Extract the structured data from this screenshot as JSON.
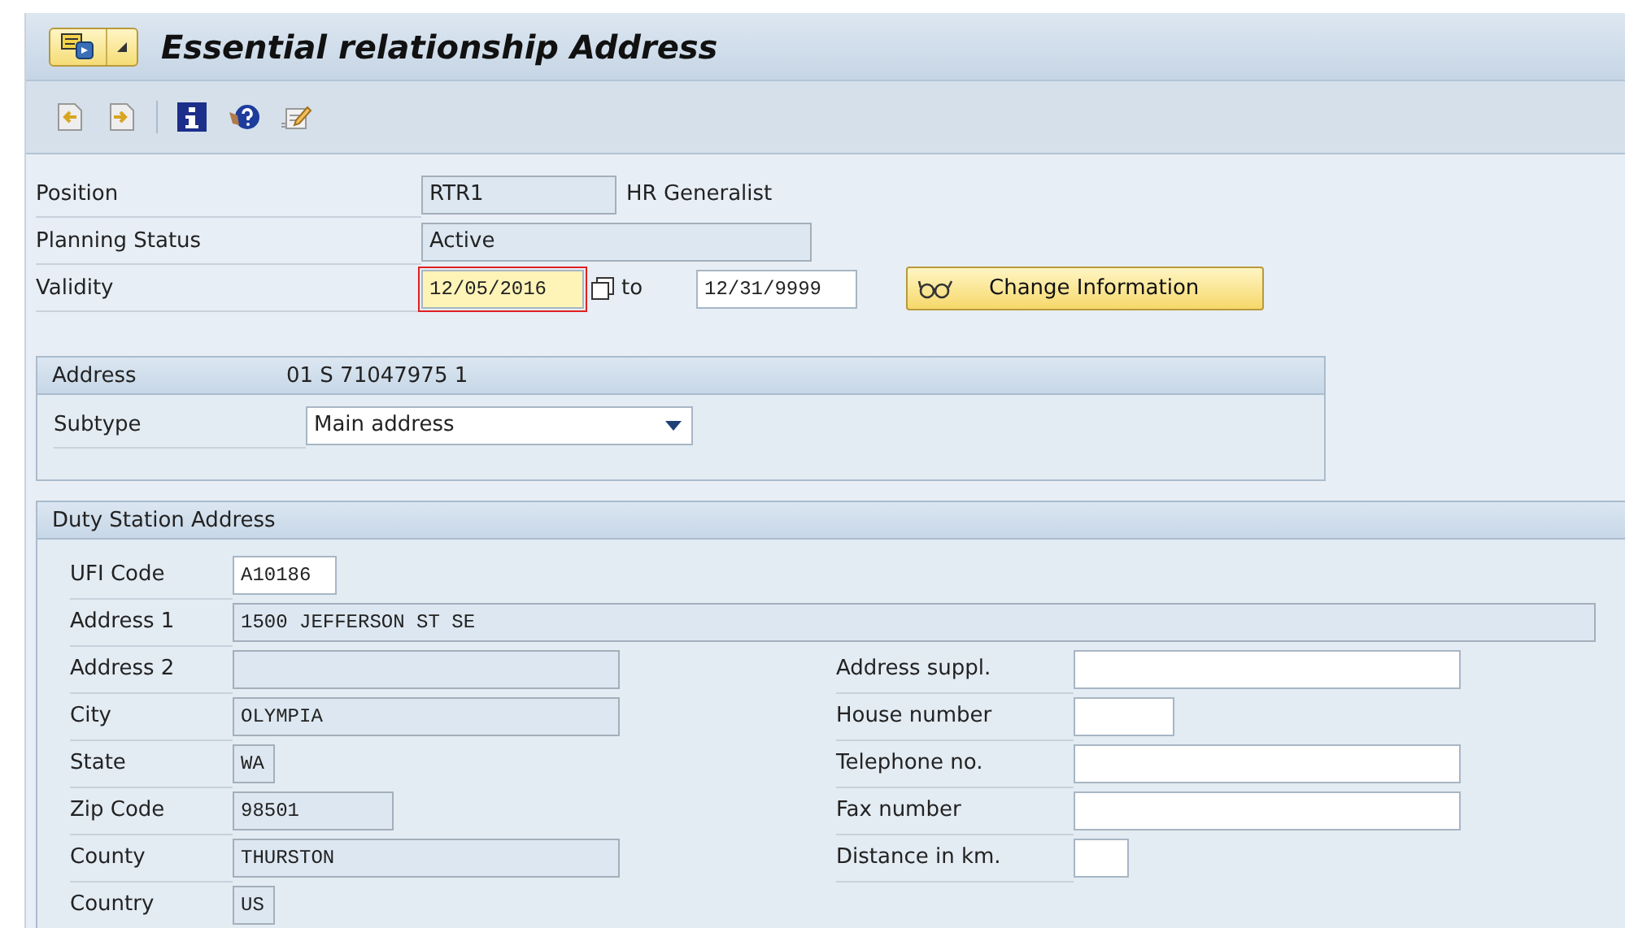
{
  "window": {
    "title": "Essential relationship Address"
  },
  "header": {
    "position": {
      "label": "Position",
      "value": "RTR1",
      "name": "HR Generalist",
      "editable": false
    },
    "planning_status": {
      "label": "Planning Status",
      "value": "Active",
      "editable": false
    },
    "validity": {
      "label": "Validity",
      "from": "12/05/2016",
      "from_focused": true,
      "to_label": "to",
      "to": "12/31/9999"
    },
    "change_button": "Change Information"
  },
  "address_group": {
    "title": "Address",
    "key": "01 S  71047975 1",
    "subtype_label": "Subtype",
    "subtype": "Main address"
  },
  "duty_station": {
    "title": "Duty Station Address",
    "left_fields": [
      {
        "label": "UFI Code",
        "value": "A10186",
        "editable": true
      },
      {
        "label": "Address 1",
        "value": "1500 JEFFERSON ST SE",
        "editable": false
      },
      {
        "label": "Address 2",
        "editable": false
      },
      {
        "label": "City",
        "value": "OLYMPIA",
        "editable": false
      },
      {
        "label": "State",
        "value": "WA",
        "editable": false
      },
      {
        "label": "Zip Code",
        "value": "98501",
        "editable": false
      },
      {
        "label": "County",
        "value": "THURSTON",
        "editable": false
      },
      {
        "label": "Country",
        "value": "US",
        "editable": false
      }
    ],
    "right_fields": [
      {
        "label": "Address suppl.",
        "editable": true
      },
      {
        "label": "House number",
        "editable": true
      },
      {
        "label": "Telephone no.",
        "editable": true
      },
      {
        "label": "Fax number",
        "editable": true
      },
      {
        "label": "Distance in km.",
        "editable": true
      }
    ]
  }
}
